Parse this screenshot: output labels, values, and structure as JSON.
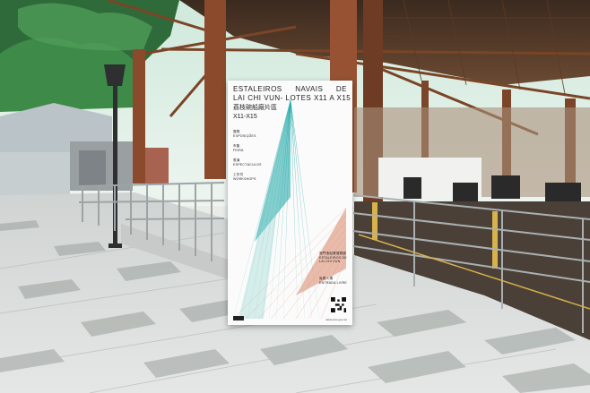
{
  "poster": {
    "title_line1_left": "ESTALEIROS",
    "title_line1_mid": "NAVAIS",
    "title_line1_right": "DE",
    "title_line2_left": "LAI CHI VUN",
    "title_line2_right": "- LOTES X11 A X15",
    "title_chinese": "荔枝碗船廠片區",
    "title_lots": "X11-X15",
    "sections": [
      {
        "zh": "展覽",
        "pt": "EXPOSIÇÕES"
      },
      {
        "zh": "市集",
        "pt": "FEIRA"
      },
      {
        "zh": "表演",
        "pt": "ESPECTÁCULOS"
      },
      {
        "zh": "工作坊",
        "pt": "WORKSHOPS"
      }
    ],
    "bottom_block": [
      {
        "zh": "澳門造船業展覽館",
        "pt": "ESTALEIROS DE LAI CHI VUN"
      },
      {
        "zh": "免費入場",
        "pt": "ENTRADA LIVRE"
      }
    ],
    "url": "www.xxxx.gov.mo"
  },
  "colors": {
    "sky": "#d9efe7",
    "steel_rust": "#8b4a2b",
    "floor": "#dfe3e1",
    "teal": "#1aa6a8",
    "coral": "#d9866a"
  }
}
